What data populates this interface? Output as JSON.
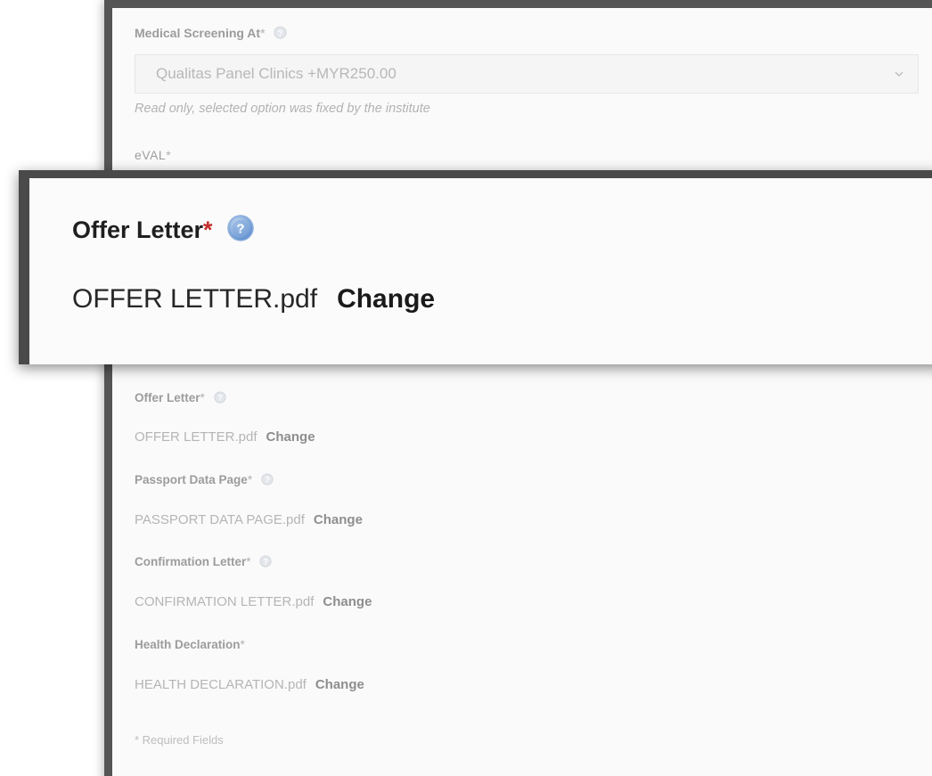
{
  "form": {
    "medical": {
      "label": "Medical Screening At",
      "required_mark": "*",
      "selected_value": "Qualitas Panel Clinics +MYR250.00",
      "hint": "Read only, selected option was fixed by the institute"
    },
    "eval": {
      "label": "eVAL",
      "required_mark": "*"
    },
    "documents": [
      {
        "label": "Offer Letter",
        "required_mark": "*",
        "file": "OFFER LETTER.pdf",
        "action": "Change"
      },
      {
        "label": "Passport Data Page",
        "required_mark": "*",
        "file": "PASSPORT DATA PAGE.pdf",
        "action": "Change"
      },
      {
        "label": "Confirmation Letter",
        "required_mark": "*",
        "file": "CONFIRMATION LETTER.pdf",
        "action": "Change"
      },
      {
        "label": "Health Declaration",
        "required_mark": "*",
        "file": "HEALTH DECLARATION.pdf",
        "action": "Change"
      }
    ],
    "required_note": "* Required Fields"
  },
  "zoom": {
    "label": "Offer Letter",
    "required_mark": "*",
    "file": "OFFER LETTER.pdf",
    "action": "Change"
  },
  "icons": {
    "help": "question-circle-icon",
    "dropdown": "chevron-down-icon"
  },
  "colors": {
    "required_star": "#c22b2b",
    "help_icon": "#7fa7d6",
    "panel_border": "#555555"
  }
}
